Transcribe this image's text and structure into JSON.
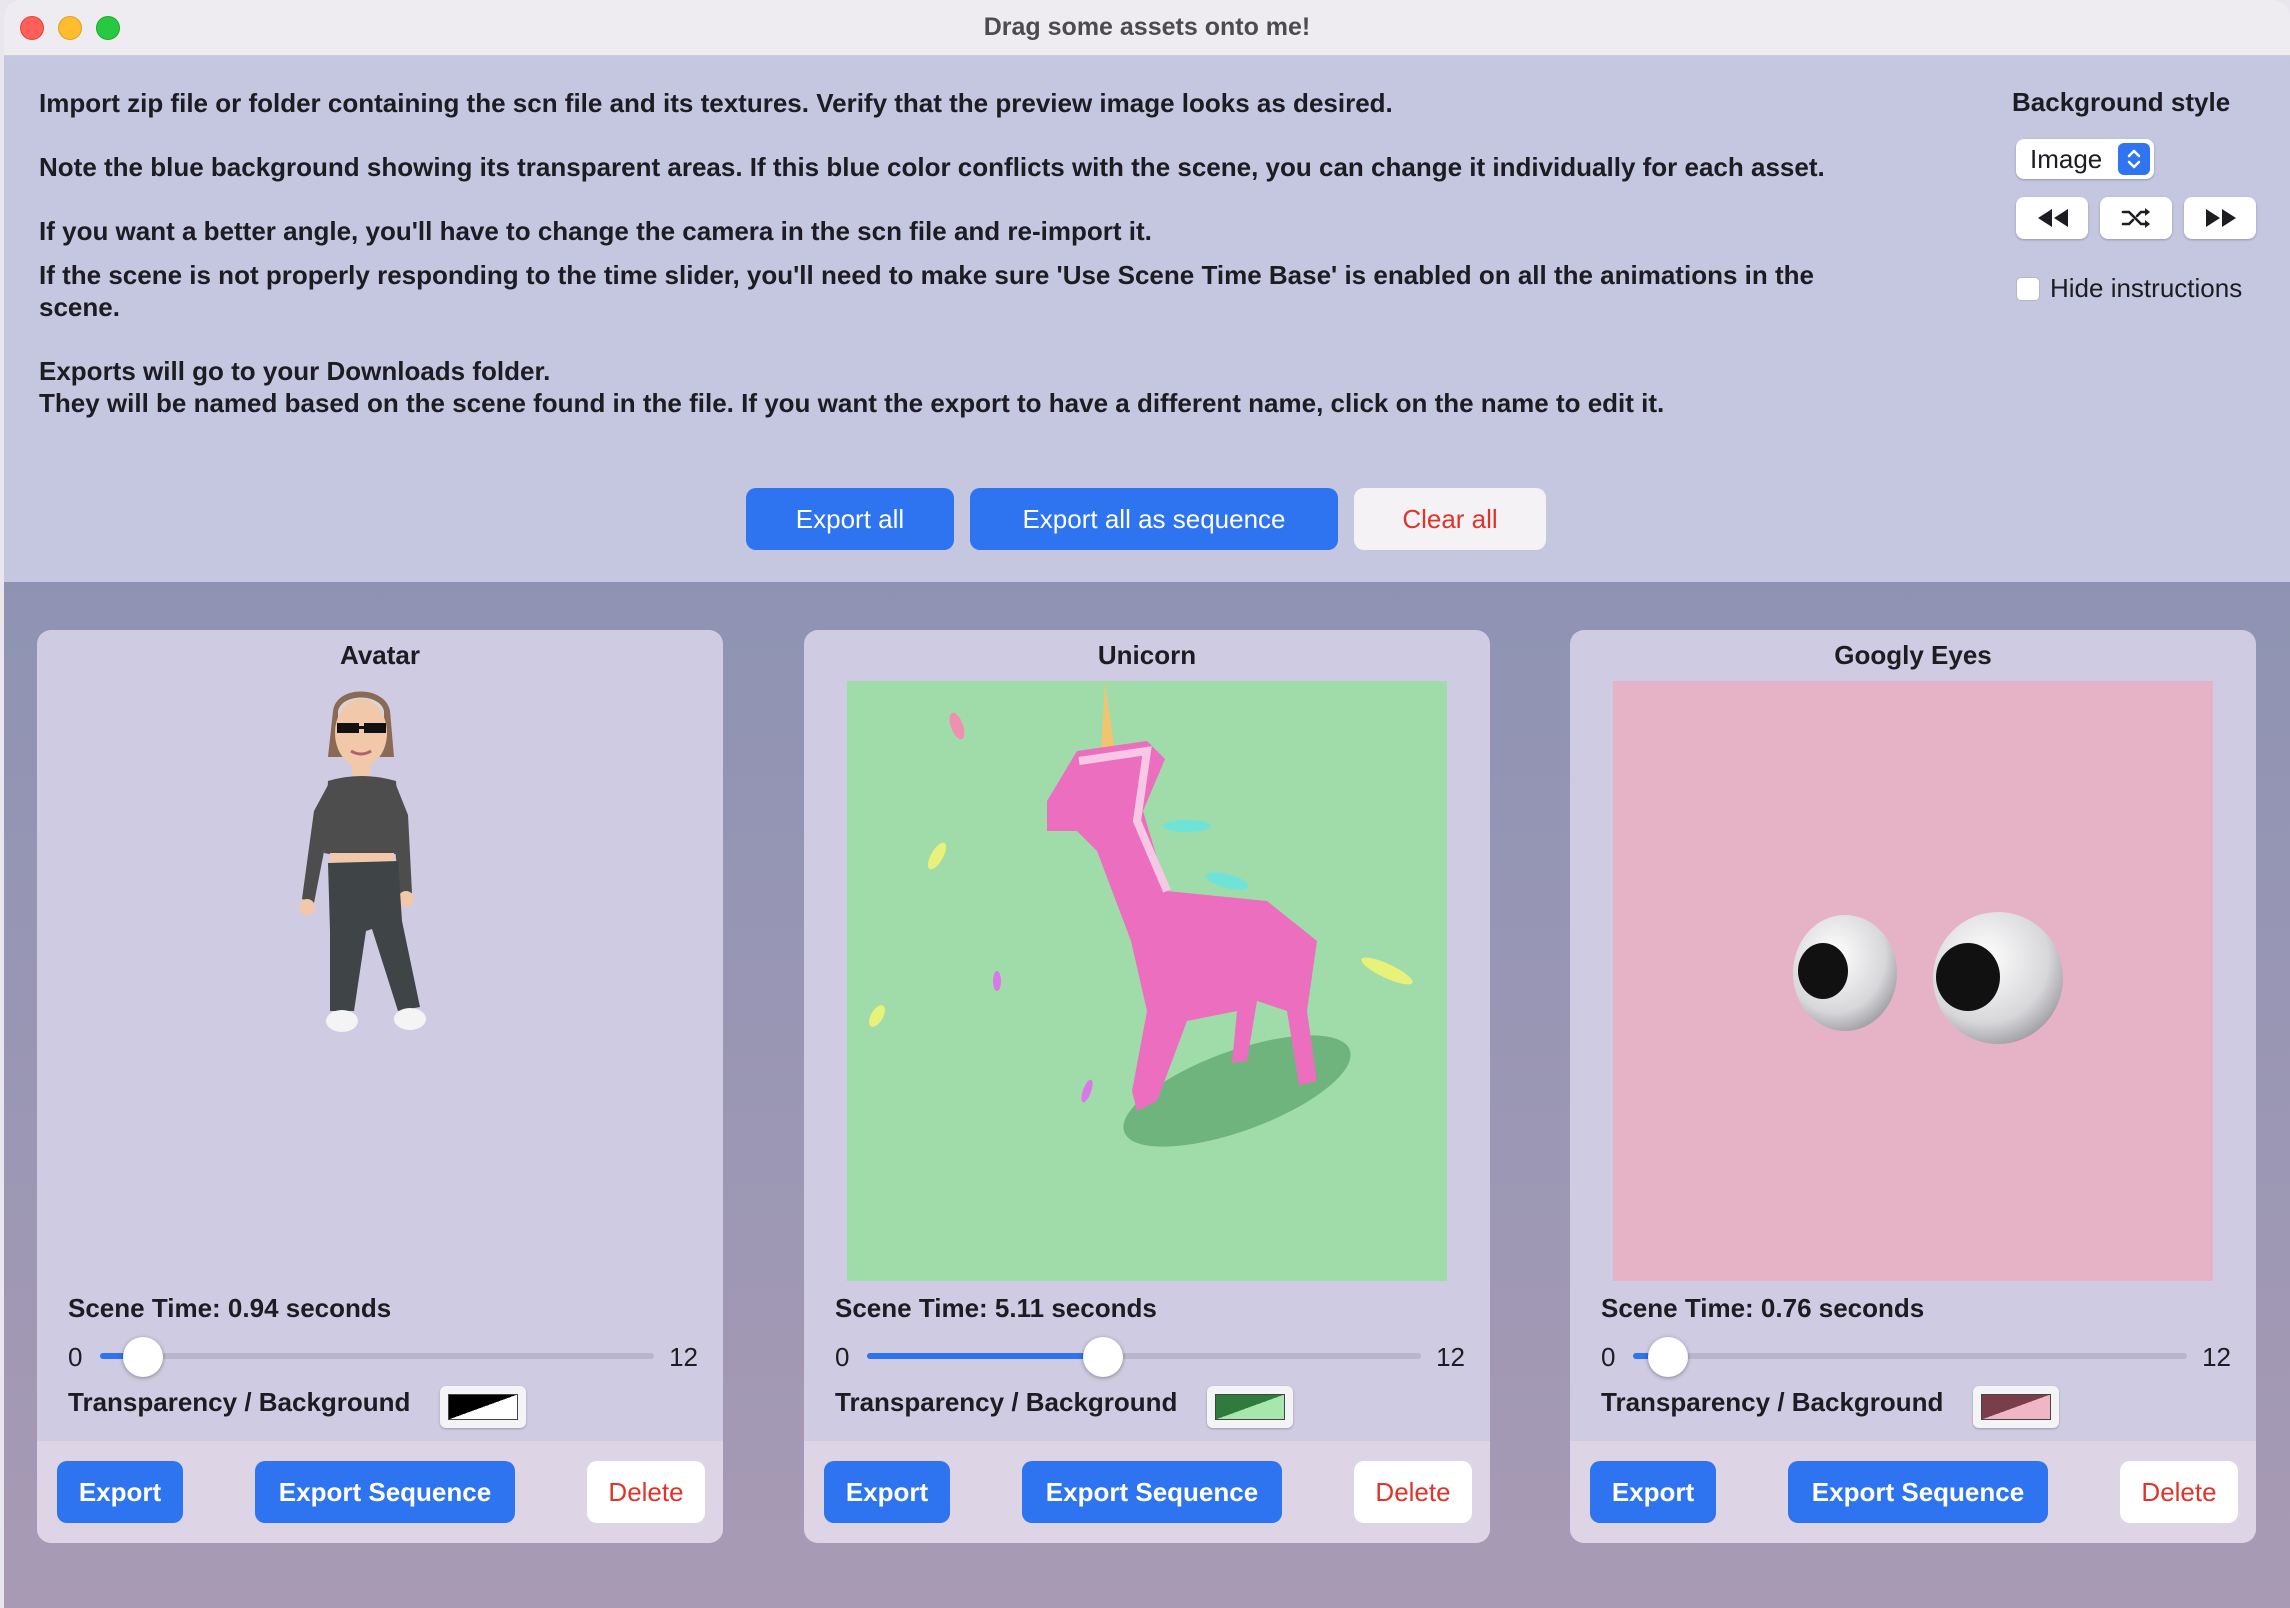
{
  "window": {
    "title": "Drag some assets onto me!"
  },
  "instructions": [
    "Import zip file or folder containing the scn file and its textures. Verify that the preview image looks as desired.",
    "Note the blue background showing its transparent areas. If this blue color conflicts with the scene, you can change it individually for each asset.",
    "If you want a better angle, you'll have to change the camera in the scn file and re-import it.",
    "If the scene is not properly responding to the time slider, you'll need to make sure 'Use Scene Time Base' is enabled on all the animations in the scene.",
    "Exports will go to your Downloads folder.",
    "They will be named based on the scene found in the file. If you want the export to have a different name, click on the name to edit it."
  ],
  "background_style": {
    "label": "Background style",
    "selected": "Image",
    "hide_instructions_label": "Hide instructions",
    "hide_instructions_checked": false
  },
  "toolbar": {
    "export_all": "Export all",
    "export_all_sequence": "Export all as sequence",
    "clear_all": "Clear all"
  },
  "assets": [
    {
      "name": "Avatar",
      "scene_time_label": "Scene Time: 0.94 seconds",
      "scene_time": 0.94,
      "slider_min": "0",
      "slider_max": "12",
      "transparency_label": "Transparency / Background",
      "swatch_colors": [
        "#000000",
        "#ffffff"
      ],
      "export_label": "Export",
      "export_sequence_label": "Export Sequence",
      "delete_label": "Delete"
    },
    {
      "name": "Unicorn",
      "scene_time_label": "Scene Time: 5.11 seconds",
      "scene_time": 5.11,
      "slider_min": "0",
      "slider_max": "12",
      "transparency_label": "Transparency / Background",
      "swatch_colors": [
        "#2f7a3c",
        "#a7e6ad"
      ],
      "export_label": "Export",
      "export_sequence_label": "Export Sequence",
      "delete_label": "Delete"
    },
    {
      "name": "Googly Eyes",
      "scene_time_label": "Scene Time: 0.76 seconds",
      "scene_time": 0.76,
      "slider_min": "0",
      "slider_max": "12",
      "transparency_label": "Transparency / Background",
      "swatch_colors": [
        "#7a3e4a",
        "#f0b6c6"
      ],
      "export_label": "Export",
      "export_sequence_label": "Export Sequence",
      "delete_label": "Delete"
    }
  ],
  "colors": {
    "accent": "#2e73ef",
    "destructive": "#e0342b",
    "unicorn_bg": "#a0dcaa",
    "googly_bg": "#e6b3c6"
  }
}
